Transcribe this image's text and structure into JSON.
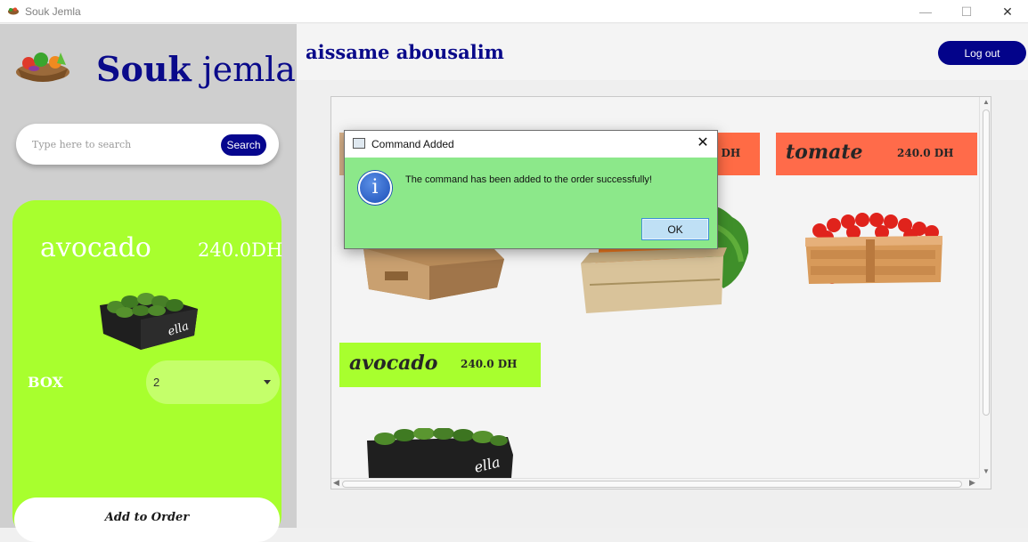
{
  "window": {
    "title": "Souk Jemla",
    "minimize_glyph": "—",
    "maximize_glyph": "☐",
    "close_glyph": "✕"
  },
  "sidebar": {
    "brand_bold": "Souk",
    "brand_rest": "jemla",
    "search": {
      "placeholder": "Type here to search",
      "value": "",
      "button_label": "Search"
    },
    "selected_product": {
      "name": "avocado",
      "price": "240.0DH",
      "unit_label": "BOX",
      "quantity": "2",
      "add_button_label": "Add to Order",
      "card_color": "#a8ff2e"
    }
  },
  "header": {
    "user_name": "aissame abousalim",
    "logout_label": "Log out"
  },
  "products": [
    {
      "name": "",
      "price": "",
      "banner_color": "#d9b38c",
      "icon": "potato-crate-image"
    },
    {
      "name": "",
      "price": "0 DH",
      "banner_color": "#ff6b45",
      "icon": "carrot-crate-image"
    },
    {
      "name": "tomate",
      "price": "240.0 DH",
      "banner_color": "#ff6b4a",
      "icon": "tomato-crate-image"
    },
    {
      "name": "avocado",
      "price": "240.0 DH",
      "banner_color": "#a8ff2e",
      "icon": "avocado-box-image"
    }
  ],
  "dialog": {
    "title": "Command Added",
    "message": "The command has been added to the order successfully!",
    "ok_label": "OK",
    "icon": "info-icon",
    "close_glyph": "✕",
    "info_glyph": "i"
  },
  "colors": {
    "brand_navy": "#0a0a8a",
    "dialog_bg": "#8ce88a",
    "sidebar_bg": "#cfcfcf"
  }
}
